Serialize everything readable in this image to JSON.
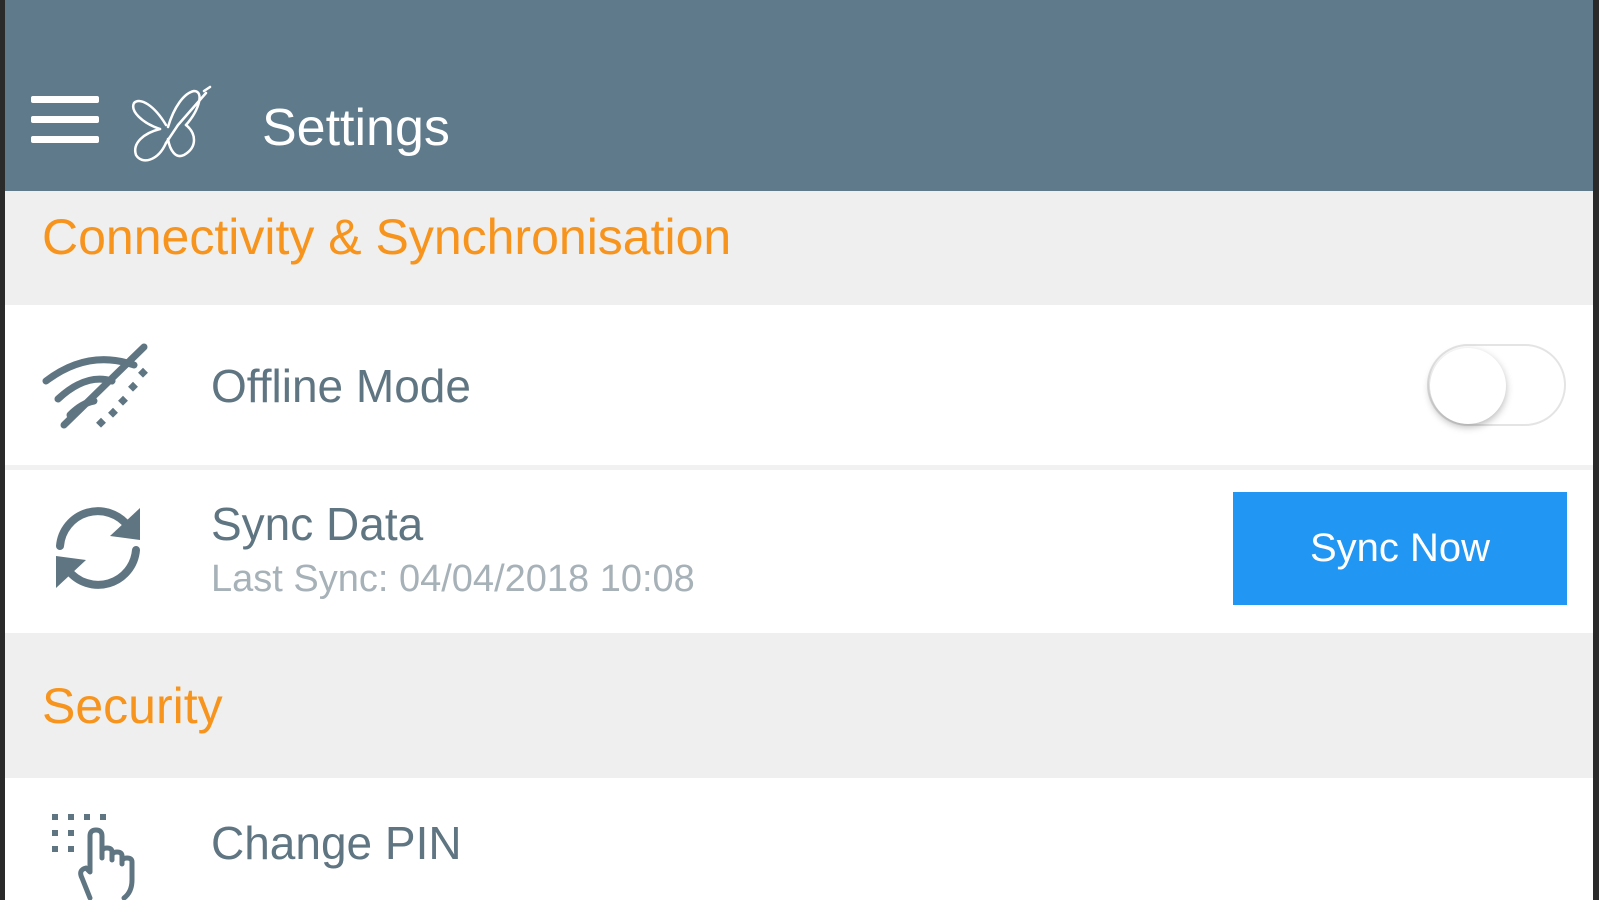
{
  "app": {
    "title": "Settings",
    "logo": "butterfly-logo-icon",
    "menu_icon": "hamburger-menu-icon"
  },
  "colors": {
    "header_bg": "#5f7a8b",
    "section_title": "#f7941d",
    "section_bg": "#efefef",
    "label_text": "#5f7582",
    "sub_text": "#a6b1b8",
    "button_bg": "#2196f3"
  },
  "sections": [
    {
      "title": "Connectivity & Synchronisation",
      "rows": [
        {
          "icon": "wifi-off-icon",
          "label": "Offline Mode",
          "control": "toggle",
          "toggle_on": false
        },
        {
          "icon": "sync-icon",
          "label": "Sync Data",
          "sublabel": "Last Sync: 04/04/2018 10:08",
          "button_label": "Sync Now"
        }
      ]
    },
    {
      "title": "Security",
      "rows": [
        {
          "icon": "pin-keypad-touch-icon",
          "label": "Change PIN"
        }
      ]
    }
  ]
}
